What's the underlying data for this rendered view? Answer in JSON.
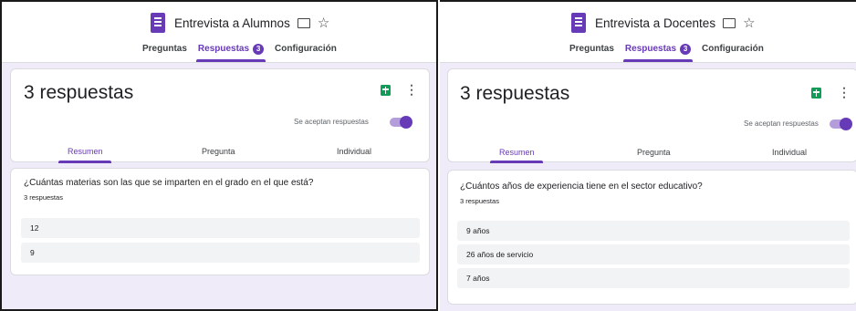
{
  "left": {
    "form_title": "Entrevista a Alumnos",
    "tabs": [
      {
        "label": "Preguntas"
      },
      {
        "label": "Respuestas",
        "badge": "3"
      },
      {
        "label": "Configuración"
      }
    ],
    "response_count": "3 respuestas",
    "accept_label": "Se aceptan respuestas",
    "subtabs": [
      "Resumen",
      "Pregunta",
      "Individual"
    ],
    "question": "¿Cuántas materias son las que se imparten en el grado en el que está?",
    "question_count": "3 respuestas",
    "answers": [
      "12",
      "9"
    ]
  },
  "right": {
    "form_title": "Entrevista a Docentes",
    "tabs": [
      {
        "label": "Preguntas"
      },
      {
        "label": "Respuestas",
        "badge": "3"
      },
      {
        "label": "Configuración"
      }
    ],
    "response_count": "3 respuestas",
    "accept_label": "Se aceptan respuestas",
    "subtabs": [
      "Resumen",
      "Pregunta",
      "Individual"
    ],
    "question": "¿Cuántos años de experiencia tiene en el sector educativo?",
    "question_count": "3 respuestas",
    "answers": [
      "9 años",
      "26 años de servicio",
      "7 años"
    ]
  },
  "colors": {
    "accent": "#673ab7",
    "background": "#f0ebf8",
    "sheets": "#0f9d58"
  },
  "icons": [
    "form-icon",
    "folder-icon",
    "star-icon",
    "sheets-icon",
    "more-icon"
  ]
}
